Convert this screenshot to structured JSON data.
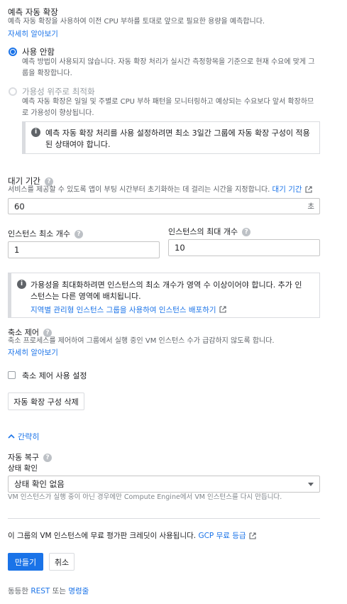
{
  "predictive": {
    "title": "예측 자동 확장",
    "description": "예측 자동 확장을 사용하여 이전 CPU 부하를 토대로 앞으로 필요한 용량을 예측합니다.",
    "learn_more": "자세히 알아보기",
    "option_off_label": "사용 안함",
    "option_off_desc_1": "예측 방법이 사용되지 않습니다. 자동 확장 처리가 실시간 측정항목을 기준으로 현재 수요에 맞게 그",
    "option_off_desc_2": "룹을 확장합니다.",
    "option_opt_label": "가용성 위주로 최적화",
    "option_opt_desc_1": "예측 자동 확장은 일일 및 주별로 CPU 부하 패턴을 모니터링하고 예상되는 수요보다 앞서 확장하므",
    "option_opt_desc_2": "로 가용성이 향상됩니다.",
    "info_1": "예측 자동 확장 처리를 사용 설정하려면 최소 3일간 그룹에 자동 확장 구성이 적용",
    "info_2": "된 상태여야 합니다."
  },
  "cooldown": {
    "label": "대기 기간",
    "description": "서비스를 제공할 수 있도록 앱이 부팅 시간부터 초기화하는 데 걸리는 시간을 지정합니다.",
    "link": "대기 기간",
    "value": "60",
    "unit": "초"
  },
  "instances": {
    "min_label": "인스턴스 최소 개수",
    "min_value": "1",
    "max_label": "인스턴스의 최대 개수",
    "max_value": "10",
    "info_1": "가용성을 최대화하려면 인스턴스의 최소 개수가 영역 수 이상이어야 합니다. 추가 인",
    "info_2": "스턴스는 다른 영역에 배치됩니다.",
    "info_link": "지역별 관리형 인스턴스 그룹을 사용하여 인스턴스 배포하기"
  },
  "scale_in": {
    "title": "축소 제어",
    "description": "축소 프로세스를 제어하여 그룹에서 실행 중인 VM 인스턴스 수가 급감하지 않도록 합니다.",
    "learn_more": "자세히 알아보기",
    "checkbox_label": "축소 제어 사용 설정",
    "delete_button": "자동 확장 구성 삭제"
  },
  "less_toggle": "간략히",
  "autoheal": {
    "title": "자동 복구",
    "health_label": "상태 확인",
    "health_value": "상태 확인 없음",
    "hint": "VM 인스턴스가 실행 중이 아닌 경우에만 Compute Engine에서 VM 인스턴스를 다시 만듭니다."
  },
  "credit": {
    "text": "이 그룹의 VM 인스턴스에 무료 평가판 크레딧이 사용됩니다.",
    "link": "GCP 무료 등급"
  },
  "actions": {
    "create": "만들기",
    "cancel": "취소"
  },
  "footer": {
    "prefix": "동등한",
    "rest": "REST",
    "or": "또는",
    "cli": "명령줄"
  },
  "colors": {
    "accent": "#1a73e8",
    "muted": "#5f6368",
    "border": "#dadce0"
  }
}
